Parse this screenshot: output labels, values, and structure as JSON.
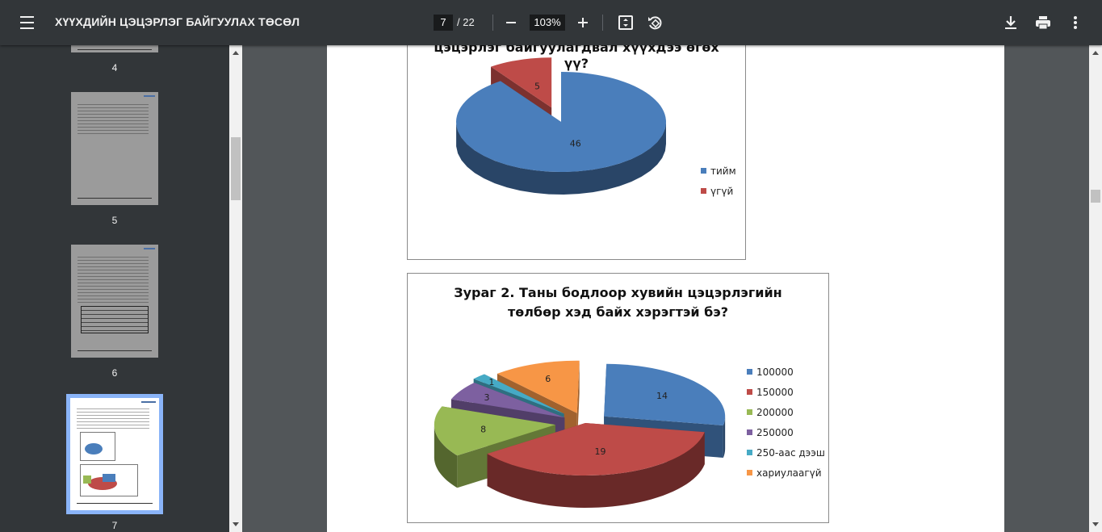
{
  "toolbar": {
    "title": "ХҮҮХДИЙН ЦЭЦЭРЛЭГ БАЙГУУЛАХ ТӨСӨЛ",
    "page_current": "7",
    "page_total": "/ 22",
    "zoom": "103%",
    "icons": [
      "menu-icon",
      "zoom-out-icon",
      "zoom-in-icon",
      "fit-page-icon",
      "rotate-icon",
      "download-icon",
      "print-icon",
      "more-vert-icon"
    ]
  },
  "sidebar": {
    "thumbnails": [
      {
        "label": "4"
      },
      {
        "label": "5"
      },
      {
        "label": "6"
      },
      {
        "label": "7",
        "selected": true
      }
    ]
  },
  "charts": {
    "chart1": {
      "title_line1": "цэцэрлэг байгуулагдвал хүүхдээ өгөх",
      "title_line2": "үү?"
    },
    "chart2": {
      "title_line1": "Зураг 2. Таны бодлоор хувийн цэцэрлэгийн",
      "title_line2": "төлбөр  хэд байх хэрэгтэй бэ?"
    }
  },
  "chart_data": [
    {
      "type": "pie",
      "title": "цэцэрлэг байгуулагдвал хүүхдээ өгөх үү?",
      "categories": [
        "тийм",
        "үгүй"
      ],
      "values": [
        46,
        5
      ],
      "colors": [
        "#4a7ebb",
        "#be4b48"
      ],
      "legend": "right"
    },
    {
      "type": "pie",
      "title": "Зураг 2. Таны бодлоор хувийн цэцэрлэгийн төлбөр  хэд байх хэрэгтэй бэ?",
      "categories": [
        "100000",
        "150000",
        "200000",
        "250000",
        "250-аас дээш",
        "хариулаагүй"
      ],
      "values": [
        14,
        19,
        8,
        3,
        1,
        6
      ],
      "colors": [
        "#4a7ebb",
        "#be4b48",
        "#98b954",
        "#7d60a0",
        "#46aac5",
        "#f79646"
      ],
      "legend": "right"
    }
  ]
}
